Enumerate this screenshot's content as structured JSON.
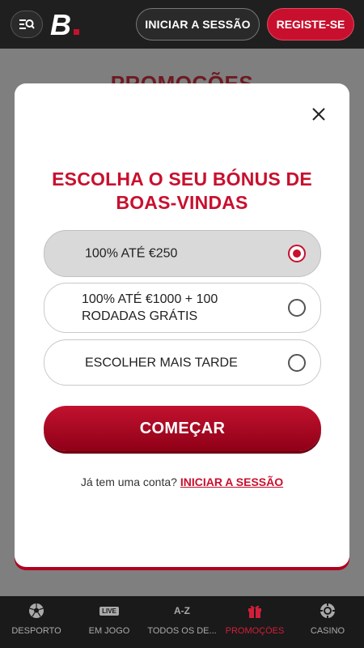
{
  "header": {
    "login_label": "INICIAR A SESSÃO",
    "register_label": "REGISTE-SE",
    "logo_text": "B."
  },
  "background": {
    "title": "PROMOÇÕES"
  },
  "modal": {
    "title": "ESCOLHA O SEU BÓNUS DE BOAS-VINDAS",
    "options": [
      {
        "label": "100% ATÉ €250",
        "selected": true
      },
      {
        "label": "100% ATÉ €1000 + 100 RODADAS GRÁTIS",
        "selected": false
      },
      {
        "label": "ESCOLHER MAIS TARDE",
        "selected": false
      }
    ],
    "start_label": "COMEÇAR",
    "account_prompt": "Já tem uma conta?",
    "account_link": "INICIAR A SESSÃO"
  },
  "bottom_nav": {
    "items": [
      {
        "label": "DESPORTO",
        "icon": "soccer-ball-icon",
        "active": false
      },
      {
        "label": "EM JOGO",
        "icon": "live-icon",
        "icon_text": "LIVE",
        "active": false
      },
      {
        "label": "TODOS OS DE...",
        "icon": "az-icon",
        "icon_text": "A-Z",
        "active": false
      },
      {
        "label": "PROMOÇÕES",
        "icon": "gift-icon",
        "active": true
      },
      {
        "label": "CASINO",
        "icon": "casino-chip-icon",
        "active": false
      }
    ]
  },
  "colors": {
    "brand_red": "#c8102e",
    "header_bg": "#1f1f1f"
  }
}
